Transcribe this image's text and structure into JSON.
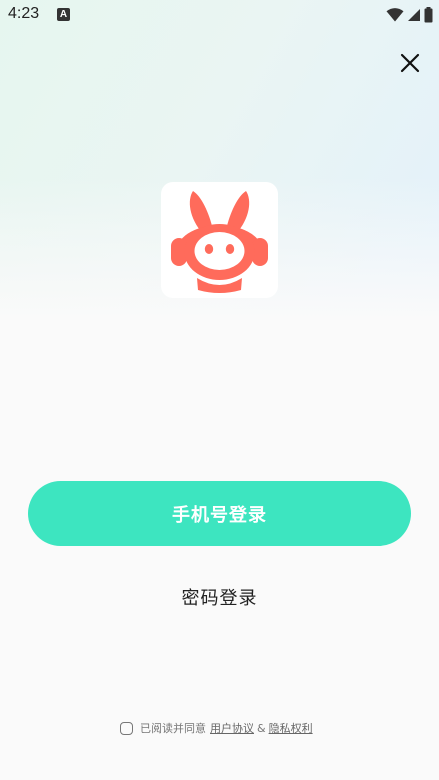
{
  "status_bar": {
    "time": "4:23",
    "app_icon_letter": "A",
    "icons": [
      "wifi-icon",
      "signal-icon",
      "battery-icon"
    ]
  },
  "close_icon": "close-icon",
  "logo": {
    "icon": "rabbit-headphones-mascot-icon",
    "colors": {
      "mascot": "#ff6b5b",
      "face": "#ffffff",
      "background": "#ffffff"
    }
  },
  "buttons": {
    "phone_login": "手机号登录",
    "password_login": "密码登录"
  },
  "agreement": {
    "prefix": "已阅读并同意",
    "user_agreement": "用户协议",
    "ampersand": "&",
    "privacy": "隐私权利"
  },
  "colors": {
    "accent": "#3de5c0",
    "text": "#222222",
    "muted": "#777777"
  }
}
